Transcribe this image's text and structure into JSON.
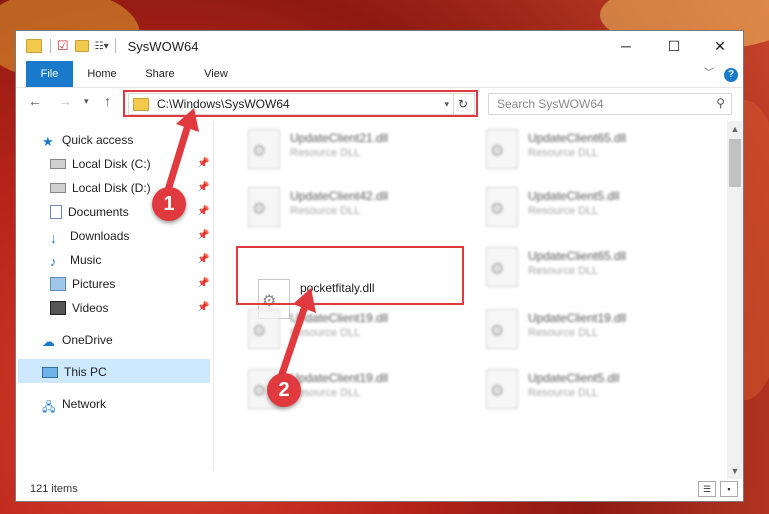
{
  "window": {
    "title": "SysWOW64",
    "controls": {
      "minimize": "─",
      "maximize": "☐",
      "close": "✕"
    }
  },
  "ribbon": {
    "tabs": [
      {
        "label": "File",
        "active": true
      },
      {
        "label": "Home"
      },
      {
        "label": "Share"
      },
      {
        "label": "View"
      }
    ],
    "expand_icon": "chevron-down-icon",
    "help_icon": "help-icon"
  },
  "address": {
    "path": "C:\\Windows\\SysWOW64",
    "search_placeholder": "Search SysWOW64"
  },
  "sidebar": {
    "items": [
      {
        "label": "Quick access",
        "icon": "star-icon",
        "pinned": false
      },
      {
        "label": "Local Disk (C:)",
        "icon": "drive-icon",
        "pinned": true
      },
      {
        "label": "Local Disk (D:)",
        "icon": "drive-icon",
        "pinned": true
      },
      {
        "label": "Documents",
        "icon": "documents-icon",
        "pinned": true
      },
      {
        "label": "Downloads",
        "icon": "download-icon",
        "pinned": true
      },
      {
        "label": "Music",
        "icon": "music-icon",
        "pinned": true
      },
      {
        "label": "Pictures",
        "icon": "pictures-icon",
        "pinned": true
      },
      {
        "label": "Videos",
        "icon": "videos-icon",
        "pinned": true
      },
      {
        "label": "OneDrive",
        "icon": "cloud-icon",
        "pinned": false
      },
      {
        "label": "This PC",
        "icon": "computer-icon",
        "pinned": false,
        "selected": true
      },
      {
        "label": "Network",
        "icon": "network-icon",
        "pinned": false
      }
    ]
  },
  "files": [
    {
      "name": "UpdateClient21.dll",
      "type": "Resource DLL"
    },
    {
      "name": "UpdateClient65.dll",
      "type": "Resource DLL"
    },
    {
      "name": "UpdateClient42.dll",
      "type": "Resource DLL"
    },
    {
      "name": "UpdateClient5.dll",
      "type": "Resource DLL"
    },
    {
      "name": "pocketfitaly.dll",
      "type": ""
    },
    {
      "name": "UpdateClient65.dll",
      "type": "Resource DLL"
    },
    {
      "name": "UpdateClient19.dll",
      "type": "Resource DLL"
    },
    {
      "name": "UpdateClient19.dll",
      "type": "Resource DLL"
    },
    {
      "name": "UpdateClient19.dll",
      "type": "Resource DLL"
    },
    {
      "name": "UpdateClient5.dll",
      "type": "Resource DLL"
    }
  ],
  "status": {
    "item_count": "121 items"
  },
  "callouts": {
    "one": "1",
    "two": "2"
  },
  "colors": {
    "accent": "#1979ca",
    "highlight_red": "#e03a3e",
    "selection": "#cde8ff"
  }
}
